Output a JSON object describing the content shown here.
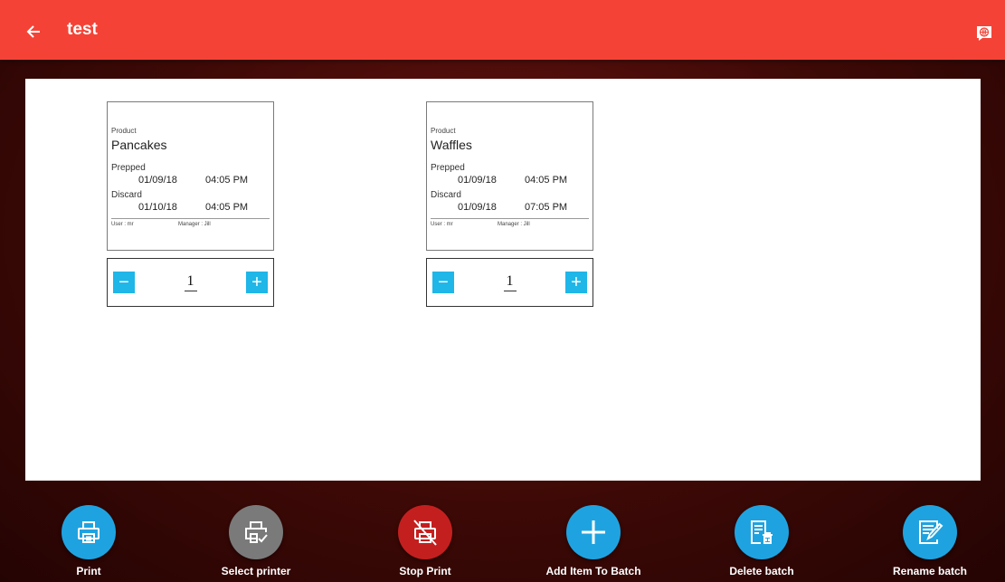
{
  "appbar": {
    "title": "test",
    "back_icon": "arrow-left-icon",
    "language_icon": "globe-chat-icon",
    "color": "#f44336"
  },
  "labels": [
    {
      "product_caption": "Product",
      "product": "Pancakes",
      "prepped_caption": "Prepped",
      "prepped_date": "01/09/18",
      "prepped_time": "04:05 PM",
      "discard_caption": "Discard",
      "discard_date": "01/10/18",
      "discard_time": "04:05 PM",
      "user": "User :  mr",
      "manager": "Manager :  Jill",
      "quantity": "1"
    },
    {
      "product_caption": "Product",
      "product": "Waffles",
      "prepped_caption": "Prepped",
      "prepped_date": "01/09/18",
      "prepped_time": "04:05 PM",
      "discard_caption": "Discard",
      "discard_date": "01/09/18",
      "discard_time": "07:05 PM",
      "user": "User :  mr",
      "manager": "Manager :  Jill",
      "quantity": "1"
    }
  ],
  "stepper": {
    "minus": "−",
    "plus": "+",
    "color": "#1fb6e8"
  },
  "actions": [
    {
      "label": "Print",
      "icon": "printer-icon",
      "color": "#1fa3e0"
    },
    {
      "label": "Select printer",
      "icon": "printer-check-icon",
      "color": "#7a7a7a"
    },
    {
      "label": "Stop Print",
      "icon": "printer-off-icon",
      "color": "#c41f1f"
    },
    {
      "label": "Add Item To Batch",
      "icon": "plus-icon",
      "color": "#1fa3e0"
    },
    {
      "label": "Delete batch",
      "icon": "list-delete-icon",
      "color": "#1fa3e0"
    },
    {
      "label": "Rename batch",
      "icon": "list-edit-icon",
      "color": "#1fa3e0"
    }
  ]
}
